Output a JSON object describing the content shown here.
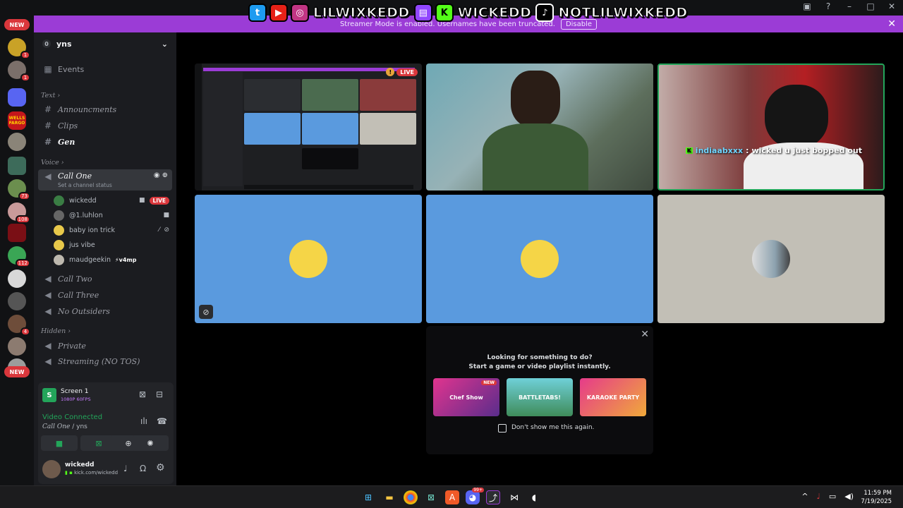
{
  "overlay": {
    "handle1": "LILWIXKEDD",
    "handle2": "WICKEDD",
    "handle3": "NOTLILWIXKEDD"
  },
  "banner": {
    "text": "Streamer Mode is enabled. Usernames have been truncated.",
    "disable_label": "Disable"
  },
  "rail": {
    "new_top": "NEW",
    "new_bottom": "NEW",
    "badges": [
      "1",
      "1",
      "73",
      "108",
      "112",
      "4"
    ],
    "wells_label": "WELLS FARGO"
  },
  "guild": {
    "name": "yns",
    "events": "Events",
    "cat_text": "Text",
    "cat_voice": "Voice",
    "cat_hidden": "Hidden",
    "channels": {
      "announcments": "Announcments",
      "clips": "Clips",
      "gen": "Gen",
      "call_one": "Call One",
      "set_status": "Set a channel status",
      "call_two": "Call Two",
      "call_three": "Call Three",
      "no_outsiders": "No Outsiders",
      "private": "Private",
      "streaming": "Streaming (NO TOS)"
    },
    "members": [
      {
        "name": "wickedd",
        "live": "LIVE"
      },
      {
        "name": "@1.luhlon"
      },
      {
        "name": "baby ion trick"
      },
      {
        "name": "jus vibe"
      },
      {
        "name": "maudgeekin",
        "tag": "v4mp"
      }
    ]
  },
  "screen_panel": {
    "title": "Screen 1",
    "quality": "1080P 60FPS"
  },
  "voice_panel": {
    "status": "Video Connected",
    "channel": "Call One",
    "server": "yns"
  },
  "user_panel": {
    "name": "wickedd",
    "status": "kick.com/wickedd"
  },
  "stream": {
    "live_label": "LIVE",
    "chat_user": "indiaabxxx",
    "chat_msg": "wicked u just bopped out"
  },
  "popup": {
    "line1": "Looking for something to do?",
    "line2": "Start a game or video playlist instantly.",
    "games": [
      "Chef Show",
      "BATTLETABS!",
      "KARAOKE PARTY"
    ],
    "new_tag": "NEW",
    "checkbox_label": "Don't show me this again."
  },
  "taskbar": {
    "discord_badge": "99+",
    "time": "11:59 PM",
    "date": "7/19/2025"
  },
  "colors": {
    "accent": "#9b3cd6",
    "voice_green": "#23a55a",
    "live_red": "#da373c",
    "tile_blue": "#5a9ade",
    "tile_grey": "#c2bfb6"
  }
}
